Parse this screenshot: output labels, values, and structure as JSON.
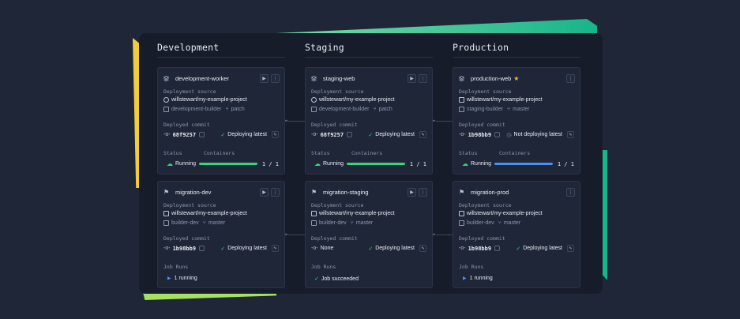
{
  "stages": [
    "Development",
    "Staging",
    "Production"
  ],
  "labels": {
    "deployment_source": "Deployment source",
    "deployed_commit": "Deployed commit",
    "status": "Status",
    "containers": "Containers",
    "job_runs": "Job Runs"
  },
  "colors": {
    "accent_green": "#3ed07c",
    "accent_blue": "#4c8ff0",
    "star": "#f5b82e"
  },
  "services": [
    {
      "name": "development-worker",
      "repo": "willstewart/my-example-project",
      "builder": "development-builder",
      "branch": "patch",
      "commit": "68f9257",
      "deploy": "Deploying latest",
      "status": "Running",
      "containers": "1 / 1",
      "containers_fraction": 1.0
    },
    {
      "name": "staging-web",
      "repo": "willstewart/my-example-project",
      "builder": "development-builder",
      "branch": "patch",
      "commit": "68f9257",
      "deploy": "Deploying latest",
      "status": "Running",
      "containers": "1 / 1",
      "containers_fraction": 1.0
    },
    {
      "name": "production-web",
      "starred": true,
      "repo": "willstewart/my-example-project",
      "builder": "staging-builder",
      "branch": "master",
      "commit": "1b98bb9",
      "deploy": "Not deploying latest",
      "status": "Running",
      "containers": "1 / 1",
      "containers_fraction": 1.0
    }
  ],
  "jobs": [
    {
      "name": "migration-dev",
      "repo": "willstewart/my-example-project",
      "builder": "builder-dev",
      "branch": "master",
      "commit": "1b98bb9",
      "deploy": "Deploying latest",
      "run": "1 running"
    },
    {
      "name": "migration-staging",
      "repo": "willstewart/my-example-project",
      "builder": "builder-dev",
      "branch": "master",
      "commit": "None",
      "deploy": "Deploying latest",
      "run": "Job succeeded"
    },
    {
      "name": "migration-prod",
      "repo": "willstewart/my-example-project",
      "builder": "builder-dev",
      "branch": "master",
      "commit": "1b98bb9",
      "deploy": "Deploying latest",
      "run": "1 running"
    }
  ]
}
